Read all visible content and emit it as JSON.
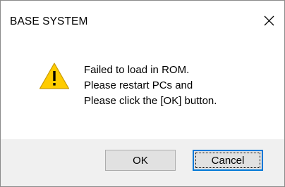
{
  "window": {
    "title": "BASE SYSTEM",
    "close_icon": "close-icon"
  },
  "message": {
    "icon": "warning-icon",
    "icon_color": "#ffcc00",
    "lines": [
      "Failed to load in ROM.",
      "Please restart PCs and",
      "Please click the [OK] button."
    ]
  },
  "buttons": {
    "ok_label": "OK",
    "cancel_label": "Cancel",
    "focused": "Cancel",
    "focus_color": "#0078d7"
  }
}
